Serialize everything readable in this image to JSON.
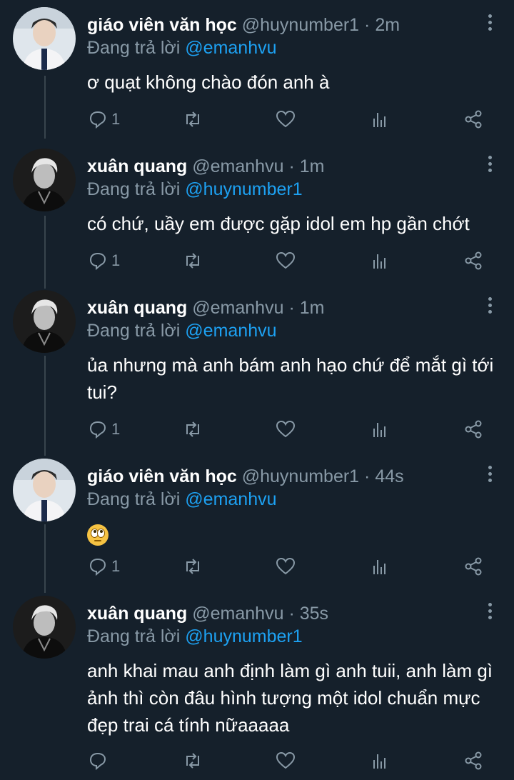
{
  "colors": {
    "background": "#15202b",
    "text": "#ffffff",
    "secondary": "#8899a6",
    "link": "#1da1f2",
    "thread_line": "#38444d"
  },
  "replying_prefix": "Đang trả lời",
  "tweets": [
    {
      "name": "giáo viên văn học",
      "handle": "@huynumber1",
      "time": "2m",
      "reply_to": "@emanhvu",
      "text": "ơ quạt không chào đón anh à",
      "reply_count": "1",
      "avatar_icon": "avatar-light-photo"
    },
    {
      "name": "xuân quang",
      "handle": "@emanhvu",
      "time": "1m",
      "reply_to": "@huynumber1",
      "text": "có chứ, uầy em được gặp idol em hp gần chớt",
      "reply_count": "1",
      "avatar_icon": "avatar-dark-photo"
    },
    {
      "name": "xuân quang",
      "handle": "@emanhvu",
      "time": "1m",
      "reply_to": "@emanhvu",
      "text": "ủa nhưng mà anh bám anh hạo chứ để mắt gì tới tui?",
      "reply_count": "1",
      "avatar_icon": "avatar-dark-photo"
    },
    {
      "name": "giáo viên văn học",
      "handle": "@huynumber1",
      "time": "44s",
      "reply_to": "@emanhvu",
      "text": "",
      "emoji": "face-with-rolling-eyes",
      "reply_count": "1",
      "avatar_icon": "avatar-light-photo"
    },
    {
      "name": "xuân quang",
      "handle": "@emanhvu",
      "time": "35s",
      "reply_to": "@huynumber1",
      "text": "anh khai mau anh định làm gì anh tuii, anh làm gì ảnh thì còn đâu hình tượng một idol chuẩn mực đẹp trai cá tính nữaaaaa",
      "reply_count": "",
      "avatar_icon": "avatar-dark-photo"
    }
  ]
}
